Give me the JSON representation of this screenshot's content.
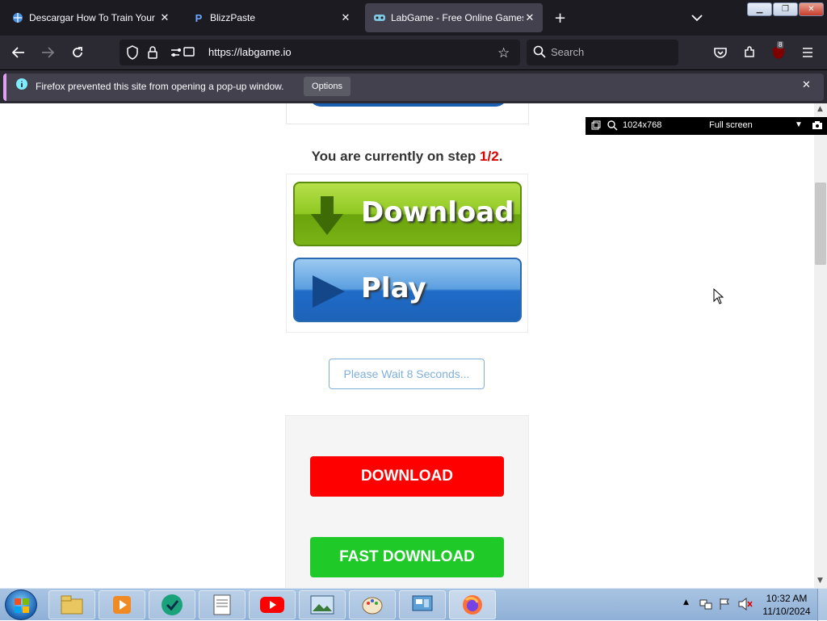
{
  "tabs": [
    {
      "title": "Descargar How To Train Your D",
      "favicon": "globe-icon",
      "active": false
    },
    {
      "title": "BlizzPaste",
      "favicon": "blizzpaste-icon",
      "active": false
    },
    {
      "title": "LabGame - Free Online Games",
      "favicon": "labgame-icon",
      "active": true
    }
  ],
  "address_bar": {
    "url": "https://labgame.io"
  },
  "search_bar": {
    "placeholder": "Search"
  },
  "extension_badge": "8",
  "notification": {
    "message": "Firefox prevented this site from opening a pop-up window.",
    "options_label": "Options"
  },
  "page": {
    "step_text_prefix": "You are currently on step ",
    "step_value": "1/2",
    "step_suffix": ".",
    "download_label": "Download",
    "play_label": "Play",
    "wait_label": "Please Wait 8 Seconds...",
    "download_red_label": "DOWNLOAD",
    "fast_download_label": "FAST DOWNLOAD"
  },
  "resolution_bar": {
    "resolution": "1024x768",
    "mode": "Full screen"
  },
  "taskbar": {
    "time": "10:32 AM",
    "date": "11/10/2024",
    "pinned": [
      "explorer-icon",
      "media-player-icon",
      "app-icon",
      "notepad-icon",
      "youtube-icon",
      "photo-viewer-icon",
      "paint-icon",
      "control-panel-icon",
      "firefox-icon"
    ]
  },
  "colors": {
    "accent_red": "#ff0000",
    "accent_green": "#1ec928",
    "step_red": "#dd0000"
  }
}
